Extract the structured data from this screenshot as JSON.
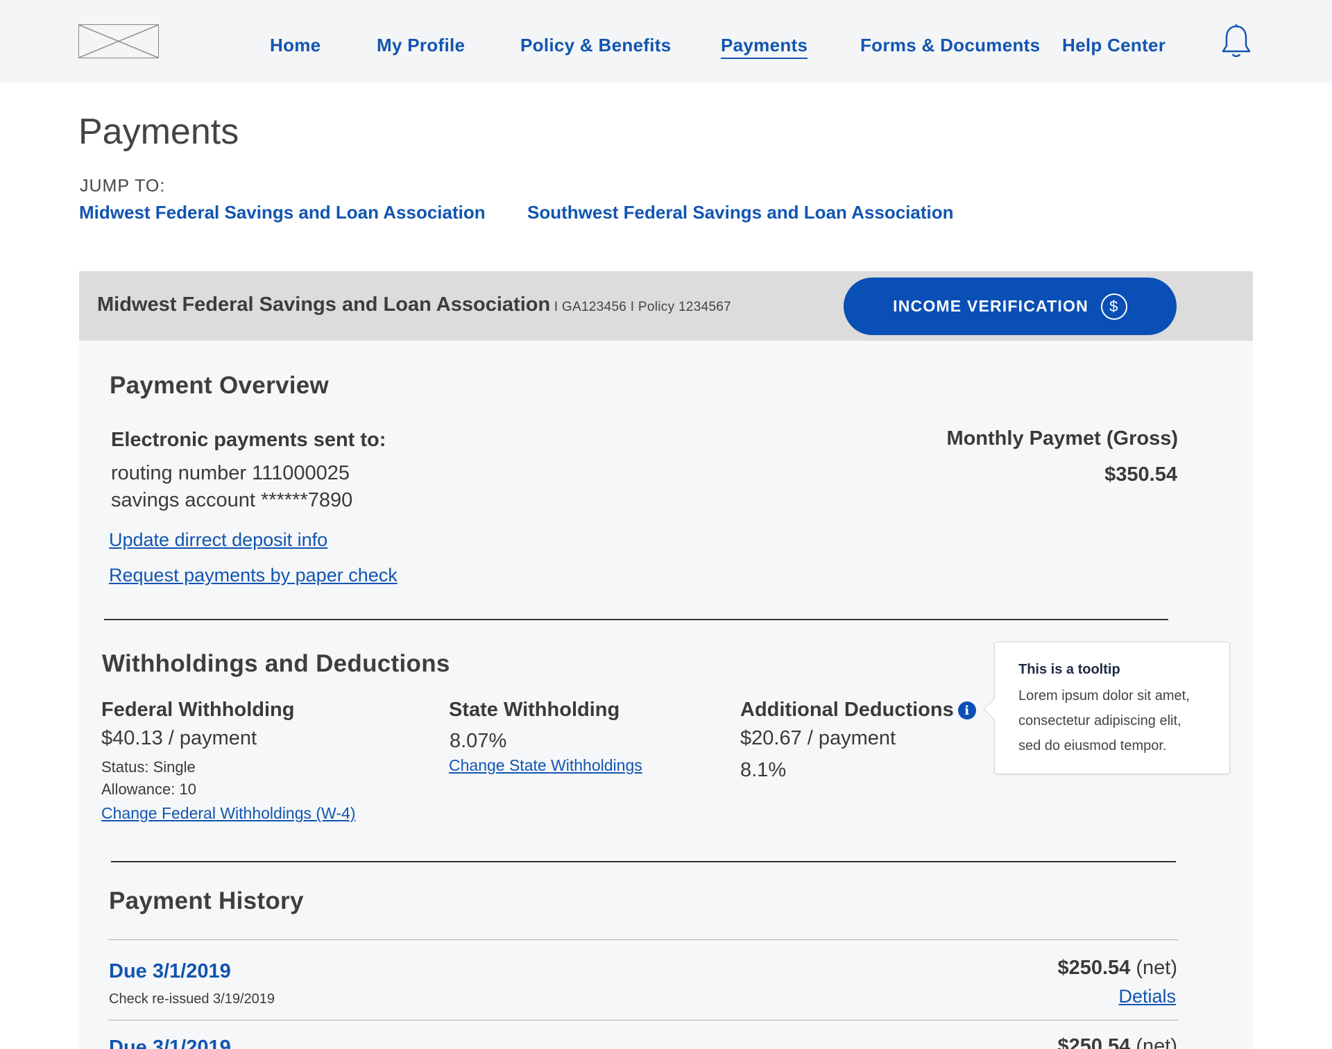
{
  "nav": {
    "logo_alt": "logo",
    "items": [
      "Home",
      "My Profile",
      "Policy & Benefits",
      "Payments",
      "Forms & Documents",
      "Help Center"
    ],
    "active": "Payments"
  },
  "page": {
    "title": "Payments",
    "jump_label": "JUMP TO:",
    "jump_links": [
      "Midwest Federal Savings and Loan Association",
      "Southwest Federal Savings and Loan Association"
    ]
  },
  "panel": {
    "name": "Midwest Federal Savings and Loan Association",
    "meta": " I GA123456 I Policy 1234567",
    "income_button": "INCOME VERIFICATION",
    "income_icon": "$"
  },
  "overview": {
    "title": "Payment Overview",
    "sent_to_label": "Electronic payments sent to:",
    "routing": "routing number 111000025",
    "account": "savings account ******7890",
    "update_link": "Update dirrect deposit info",
    "paper_link": "Request payments by paper check",
    "monthly_label": "Monthly Paymet (Gross)",
    "monthly_value": "$350.54"
  },
  "withholdings": {
    "title": "Withholdings and Deductions",
    "federal": {
      "label": "Federal Withholding",
      "amount": "$40.13 / payment",
      "status": "Status:  Single",
      "allowance": "Allowance:  10",
      "link": "Change Federal Withholdings (W-4)"
    },
    "state": {
      "label": "State  Withholding",
      "rate": "8.07%",
      "link": "Change State Withholdings"
    },
    "additional": {
      "label": "Additional Deductions",
      "amount": "$20.67 / payment",
      "rate": "8.1%"
    },
    "tooltip": {
      "title": "This is a tooltip",
      "body": "Lorem ipsum dolor sit amet, consectetur adipiscing elit, sed do eiusmod tempor."
    }
  },
  "history": {
    "title": "Payment History",
    "rows": [
      {
        "due": "Due 3/1/2019",
        "note": "Check re-issued 3/19/2019",
        "amount": "$250.54",
        "net": " (net)",
        "details": "Detials"
      },
      {
        "due": "Due 3/1/2019",
        "amount": "$250.54",
        "net": " (net)"
      }
    ]
  }
}
